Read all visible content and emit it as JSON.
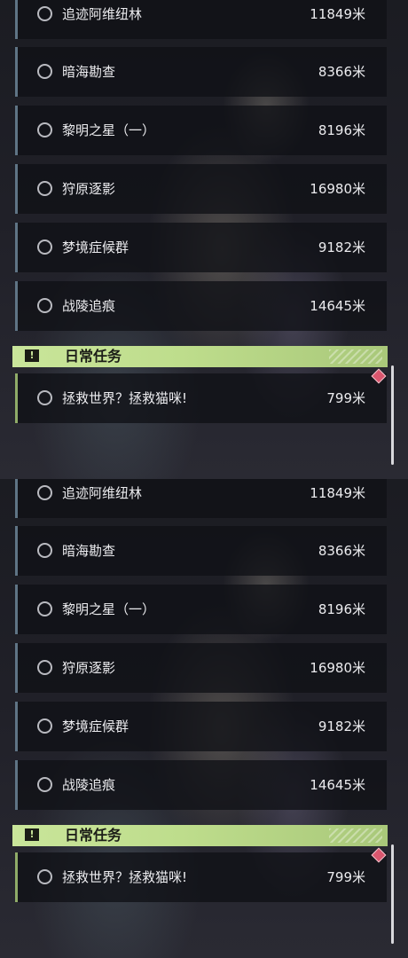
{
  "panels": [
    {
      "tasks": [
        {
          "name": "追迹阿维纽林",
          "distance": "11849米"
        },
        {
          "name": "暗海勘查",
          "distance": "8366米"
        },
        {
          "name": "黎明之星（一）",
          "distance": "8196米"
        },
        {
          "name": "狩原逐影",
          "distance": "16980米"
        },
        {
          "name": "梦境症候群",
          "distance": "9182米"
        },
        {
          "name": "战陵追痕",
          "distance": "14645米"
        }
      ],
      "section_title": "日常任务",
      "section_icon": "exclamation-icon",
      "daily_task": {
        "name": "拯救世界？拯救猫咪!",
        "distance": "799米"
      }
    },
    {
      "tasks": [
        {
          "name": "追迹阿维纽林",
          "distance": "11849米"
        },
        {
          "name": "暗海勘查",
          "distance": "8366米"
        },
        {
          "name": "黎明之星（一）",
          "distance": "8196米"
        },
        {
          "name": "狩原逐影",
          "distance": "16980米"
        },
        {
          "name": "梦境症候群",
          "distance": "9182米"
        },
        {
          "name": "战陵追痕",
          "distance": "14645米"
        }
      ],
      "section_title": "日常任务",
      "section_icon": "exclamation-icon",
      "daily_task": {
        "name": "拯救世界？拯救猫咪!",
        "distance": "799米"
      }
    }
  ],
  "colors": {
    "header_bg": "#c9e59a",
    "task_bar_accent": "#5f7485",
    "daily_bar_accent": "#8fab68",
    "alert": "#d9566e"
  }
}
